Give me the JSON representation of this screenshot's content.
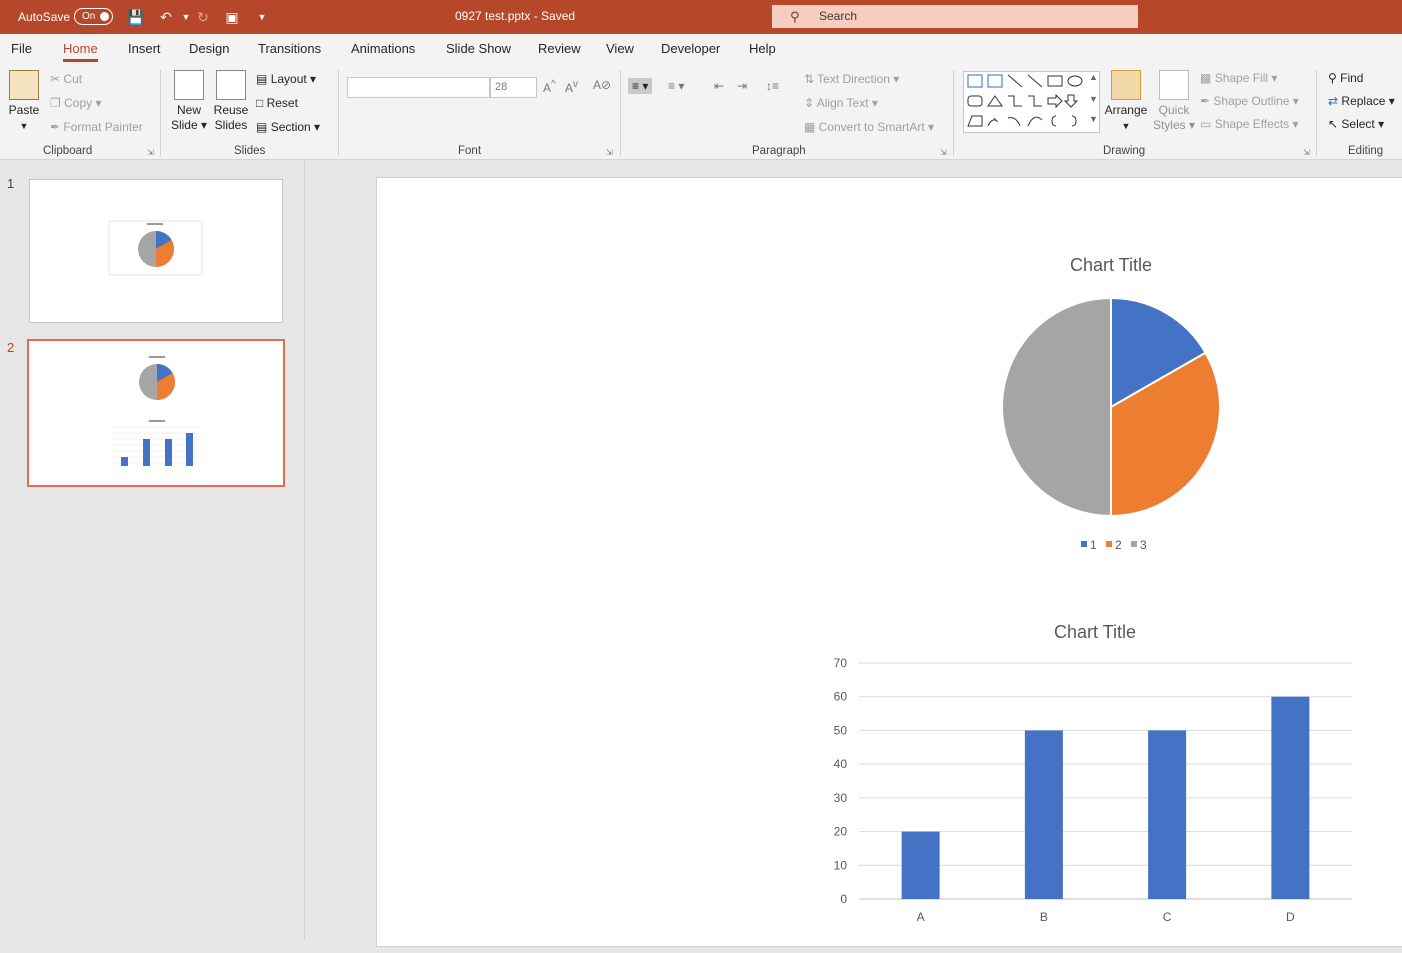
{
  "titlebar": {
    "autosave_label": "AutoSave",
    "autosave_state": "On",
    "document": "0927 test.pptx  -  Saved",
    "search_placeholder": "Search"
  },
  "tabs": [
    "File",
    "Home",
    "Insert",
    "Design",
    "Transitions",
    "Animations",
    "Slide Show",
    "Review",
    "View",
    "Developer",
    "Help"
  ],
  "active_tab": "Home",
  "ribbon": {
    "clipboard": {
      "paste": "Paste",
      "cut": "Cut",
      "copy": "Copy",
      "format_painter": "Format Painter",
      "label": "Clipboard"
    },
    "slides": {
      "new_slide_1": "New",
      "new_slide_2": "Slide",
      "reuse_1": "Reuse",
      "reuse_2": "Slides",
      "layout": "Layout",
      "reset": "Reset",
      "section": "Section",
      "label": "Slides"
    },
    "font": {
      "font_name": "",
      "font_size": "28",
      "label": "Font"
    },
    "paragraph": {
      "text_direction": "Text Direction",
      "align_text": "Align Text",
      "convert_smartart": "Convert to SmartArt",
      "label": "Paragraph"
    },
    "drawing": {
      "arrange": "Arrange",
      "quick_styles_1": "Quick",
      "quick_styles_2": "Styles",
      "shape_fill": "Shape Fill",
      "shape_outline": "Shape Outline",
      "shape_effects": "Shape Effects",
      "label": "Drawing"
    },
    "editing": {
      "find": "Find",
      "replace": "Replace",
      "select": "Select",
      "label": "Editing"
    }
  },
  "thumbnails": [
    {
      "number": "1"
    },
    {
      "number": "2",
      "selected": true
    }
  ],
  "colors": {
    "accent": "#b7472a",
    "blue": "#4472c4",
    "orange": "#ed7d31",
    "gray": "#a5a5a5"
  },
  "chart_data": [
    {
      "type": "pie",
      "title": "Chart Title",
      "categories": [
        "1",
        "2",
        "3"
      ],
      "values": [
        16.7,
        33.3,
        50
      ],
      "legend": "bottom"
    },
    {
      "type": "bar",
      "title": "Chart Title",
      "categories": [
        "A",
        "B",
        "C",
        "D"
      ],
      "values": [
        20,
        50,
        50,
        60
      ],
      "ylim": [
        0,
        70
      ],
      "yticks": [
        0,
        10,
        20,
        30,
        40,
        50,
        60,
        70
      ],
      "grid": true
    }
  ]
}
